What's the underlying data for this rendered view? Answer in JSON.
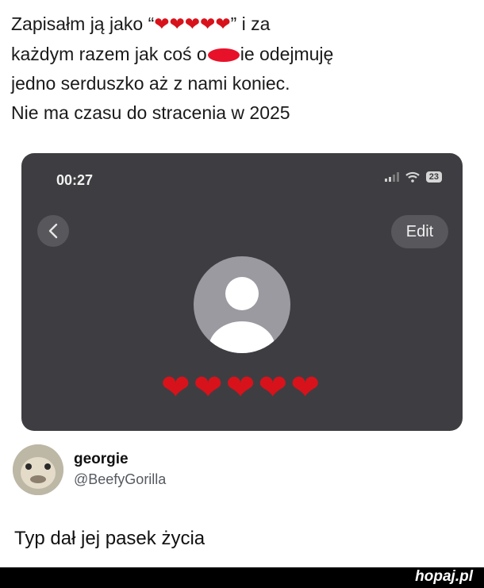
{
  "caption": {
    "line1_a": "Zapisałm ją jako “",
    "line1_hearts": "❤❤❤❤❤",
    "line1_b": "” i za",
    "line2_a": "każdym razem jak coś o",
    "line2_b": "ie odejmuję",
    "line3": "jedno serduszko aż z nami koniec.",
    "line4": "Nie ma czasu do stracenia w 2025"
  },
  "phone": {
    "time": "00:27",
    "battery": "23",
    "edit_label": "Edit",
    "back_icon": "chevron-left-icon",
    "contact_hearts": "❤❤❤❤❤",
    "background_color": "#3e3e42"
  },
  "tweet": {
    "name": "georgie",
    "handle": "@BeefyGorilla",
    "text": "Typ dał jej pasek życia"
  },
  "footer": {
    "logo": "hopaj.pl"
  }
}
